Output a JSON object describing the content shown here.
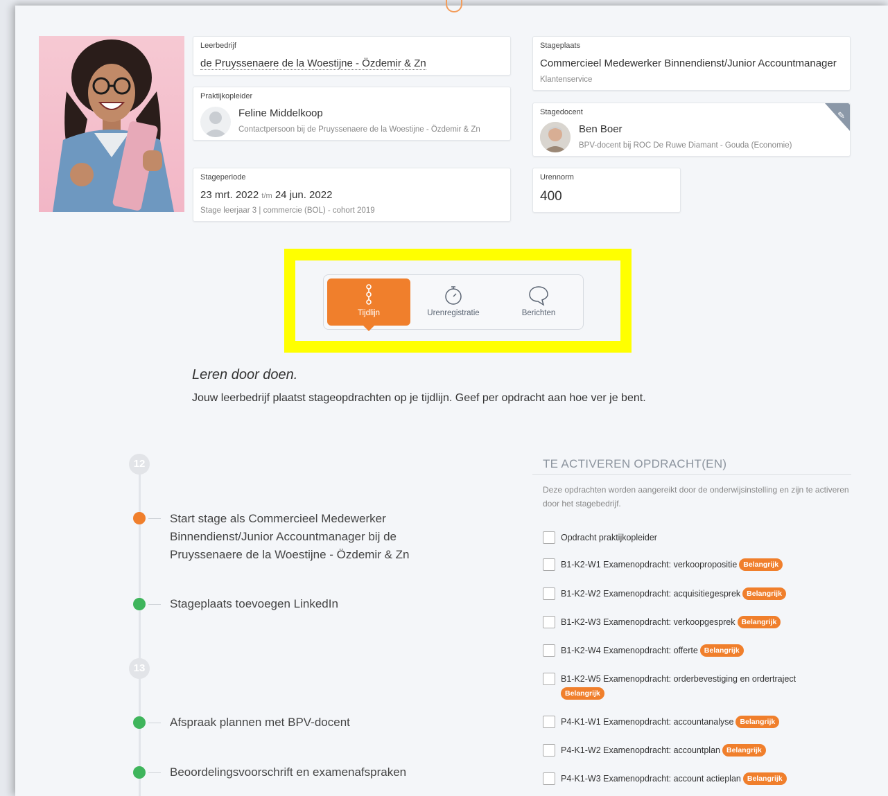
{
  "leerbedrijf": {
    "label": "Leerbedrijf",
    "value": "de Pruyssenaere de la Woestijne - Özdemir & Zn"
  },
  "praktijkopleider": {
    "label": "Praktijkopleider",
    "name": "Feline Middelkoop",
    "sub": "Contactpersoon bij de Pruyssenaere de la Woestijne - Özdemir & Zn"
  },
  "stageperiode": {
    "label": "Stageperiode",
    "start": "23 mrt. 2022",
    "sep": "t/m",
    "end": "24 jun. 2022",
    "sub": "Stage leerjaar 3 | commercie (BOL) - cohort 2019"
  },
  "stageplaats": {
    "label": "Stageplaats",
    "value": "Commercieel Medewerker Binnendienst/Junior Accountmanager",
    "sub": "Klantenservice"
  },
  "stagedocent": {
    "label": "Stagedocent",
    "name": "Ben Boer",
    "sub": "BPV-docent bij ROC De Ruwe Diamant - Gouda (Economie)"
  },
  "urennorm": {
    "label": "Urennorm",
    "value": "400"
  },
  "tabs": [
    {
      "label": "Tijdlijn",
      "icon": "timeline-icon",
      "active": true
    },
    {
      "label": "Urenregistratie",
      "icon": "stopwatch-icon",
      "active": false
    },
    {
      "label": "Berichten",
      "icon": "chat-icon",
      "active": false
    }
  ],
  "intro": {
    "title": "Leren door doen.",
    "text": "Jouw leerbedrijf plaatst stageopdrachten op je tijdlijn. Geef per opdracht aan hoe ver je bent."
  },
  "timeline": {
    "weeks": [
      "12",
      "13"
    ],
    "items": [
      {
        "text": "Start stage als Commercieel Medewerker Binnendienst/Junior Accountmanager bij de Pruyssenaere de la Woestijne - Özdemir & Zn",
        "status": "orange"
      },
      {
        "text": "Stageplaats toevoegen LinkedIn",
        "status": "green"
      },
      {
        "text": "Afspraak plannen met BPV-docent",
        "status": "green"
      },
      {
        "text": "Beoordelingsvoorschrift en examenafspraken",
        "status": "green"
      }
    ]
  },
  "activate": {
    "title": "TE ACTIVEREN OPDRACHT(EN)",
    "desc": "Deze opdrachten worden aangereikt door de onderwijsinstelling en zijn te activeren door het stagebedrijf.",
    "badge": "Belangrijk",
    "tasks": [
      {
        "text": "Opdracht praktijkopleider",
        "important": false
      },
      {
        "text": "B1-K2-W1 Examenopdracht: verkoopropositie",
        "important": true
      },
      {
        "text": "B1-K2-W2 Examenopdracht: acquisitiegesprek",
        "important": true
      },
      {
        "text": "B1-K2-W3 Examenopdracht: verkoopgesprek",
        "important": true
      },
      {
        "text": "B1-K2-W4 Examenopdracht: offerte",
        "important": true
      },
      {
        "text": "B1-K2-W5 Examenopdracht: orderbevestiging en ordertraject",
        "important": true
      },
      {
        "text": "P4-K1-W1 Examenopdracht: accountanalyse",
        "important": true
      },
      {
        "text": "P4-K1-W2 Examenopdracht: accountplan",
        "important": true
      },
      {
        "text": "P4-K1-W3 Examenopdracht: account actieplan",
        "important": true
      }
    ]
  },
  "colors": {
    "accent": "#f07f2c",
    "green": "#3fb55c",
    "highlight": "#ffff00"
  }
}
